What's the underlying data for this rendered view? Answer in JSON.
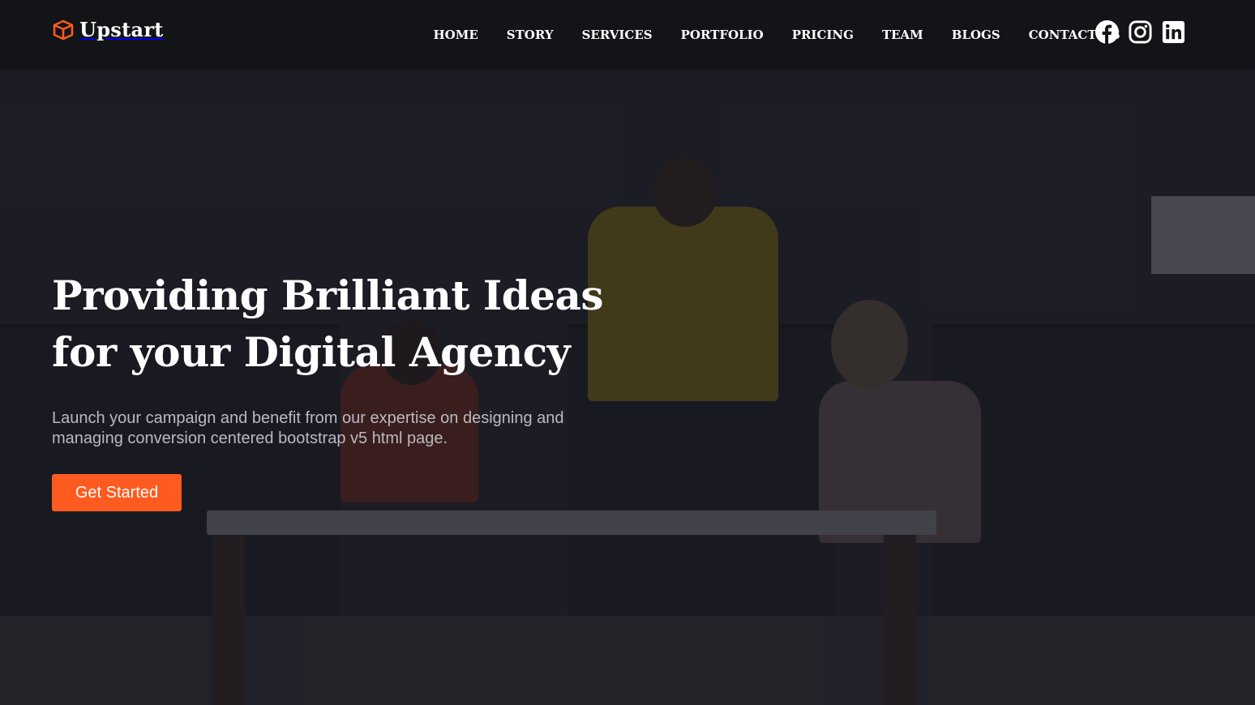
{
  "brand": {
    "name": "Upstart",
    "icon": "cube-logo-icon",
    "accent_color": "#ff5a1f"
  },
  "nav": {
    "items": [
      "HOME",
      "STORY",
      "SERVICES",
      "PORTFOLIO",
      "PRICING",
      "TEAM",
      "BLOGS",
      "CONTACT US"
    ]
  },
  "socials": {
    "icons": [
      "facebook-icon",
      "instagram-icon",
      "linkedin-icon"
    ]
  },
  "hero": {
    "title_line1": "Providing Brilliant Ideas",
    "title_line2": "for your Digital Agency",
    "subtitle": "Launch your campaign and benefit from our expertise on designing and managing conversion centered bootstrap v5 html page.",
    "cta_label": "Get Started",
    "cta_color": "#ff5a1f"
  }
}
